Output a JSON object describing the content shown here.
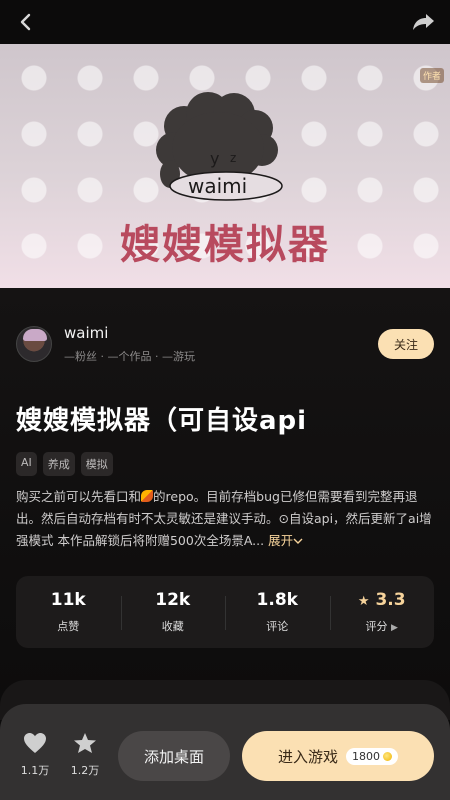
{
  "topbar": {
    "back_icon": "chevron-left-icon",
    "share_icon": "share-icon"
  },
  "cover": {
    "title": "嫂嫂模拟器",
    "author_tag": "作者",
    "art_text": "waimi"
  },
  "author": {
    "name": "waimi",
    "stats": "—粉丝 · —个作品 · —游玩",
    "follow_label": "关注"
  },
  "game": {
    "title": "嫂嫂模拟器（可自设api",
    "tags": [
      "AI",
      "养成",
      "模拟"
    ],
    "desc_part1": "购买之前可以先看口和",
    "desc_part2": "的repo。目前存档bug已修但需要看到完整再退出。然后自动存档有时不太灵敏还是建议手动。⊙自设api，然后更新了ai增强模式 本作品解锁后将附赠500次全场景A...",
    "expand_label": "展开"
  },
  "stats": [
    {
      "value": "11k",
      "label": "点赞"
    },
    {
      "value": "12k",
      "label": "收藏"
    },
    {
      "value": "1.8k",
      "label": "评论"
    }
  ],
  "rating": {
    "value": "3.3",
    "label": "评分"
  },
  "bottom": {
    "like_count": "1.1万",
    "star_count": "1.2万",
    "add_desktop": "添加桌面",
    "enter_game": "进入游戏",
    "price": "1800"
  },
  "colors": {
    "accent": "#fbe0b3",
    "title_pink": "#b84a5e",
    "background": "#0c0b0b"
  }
}
